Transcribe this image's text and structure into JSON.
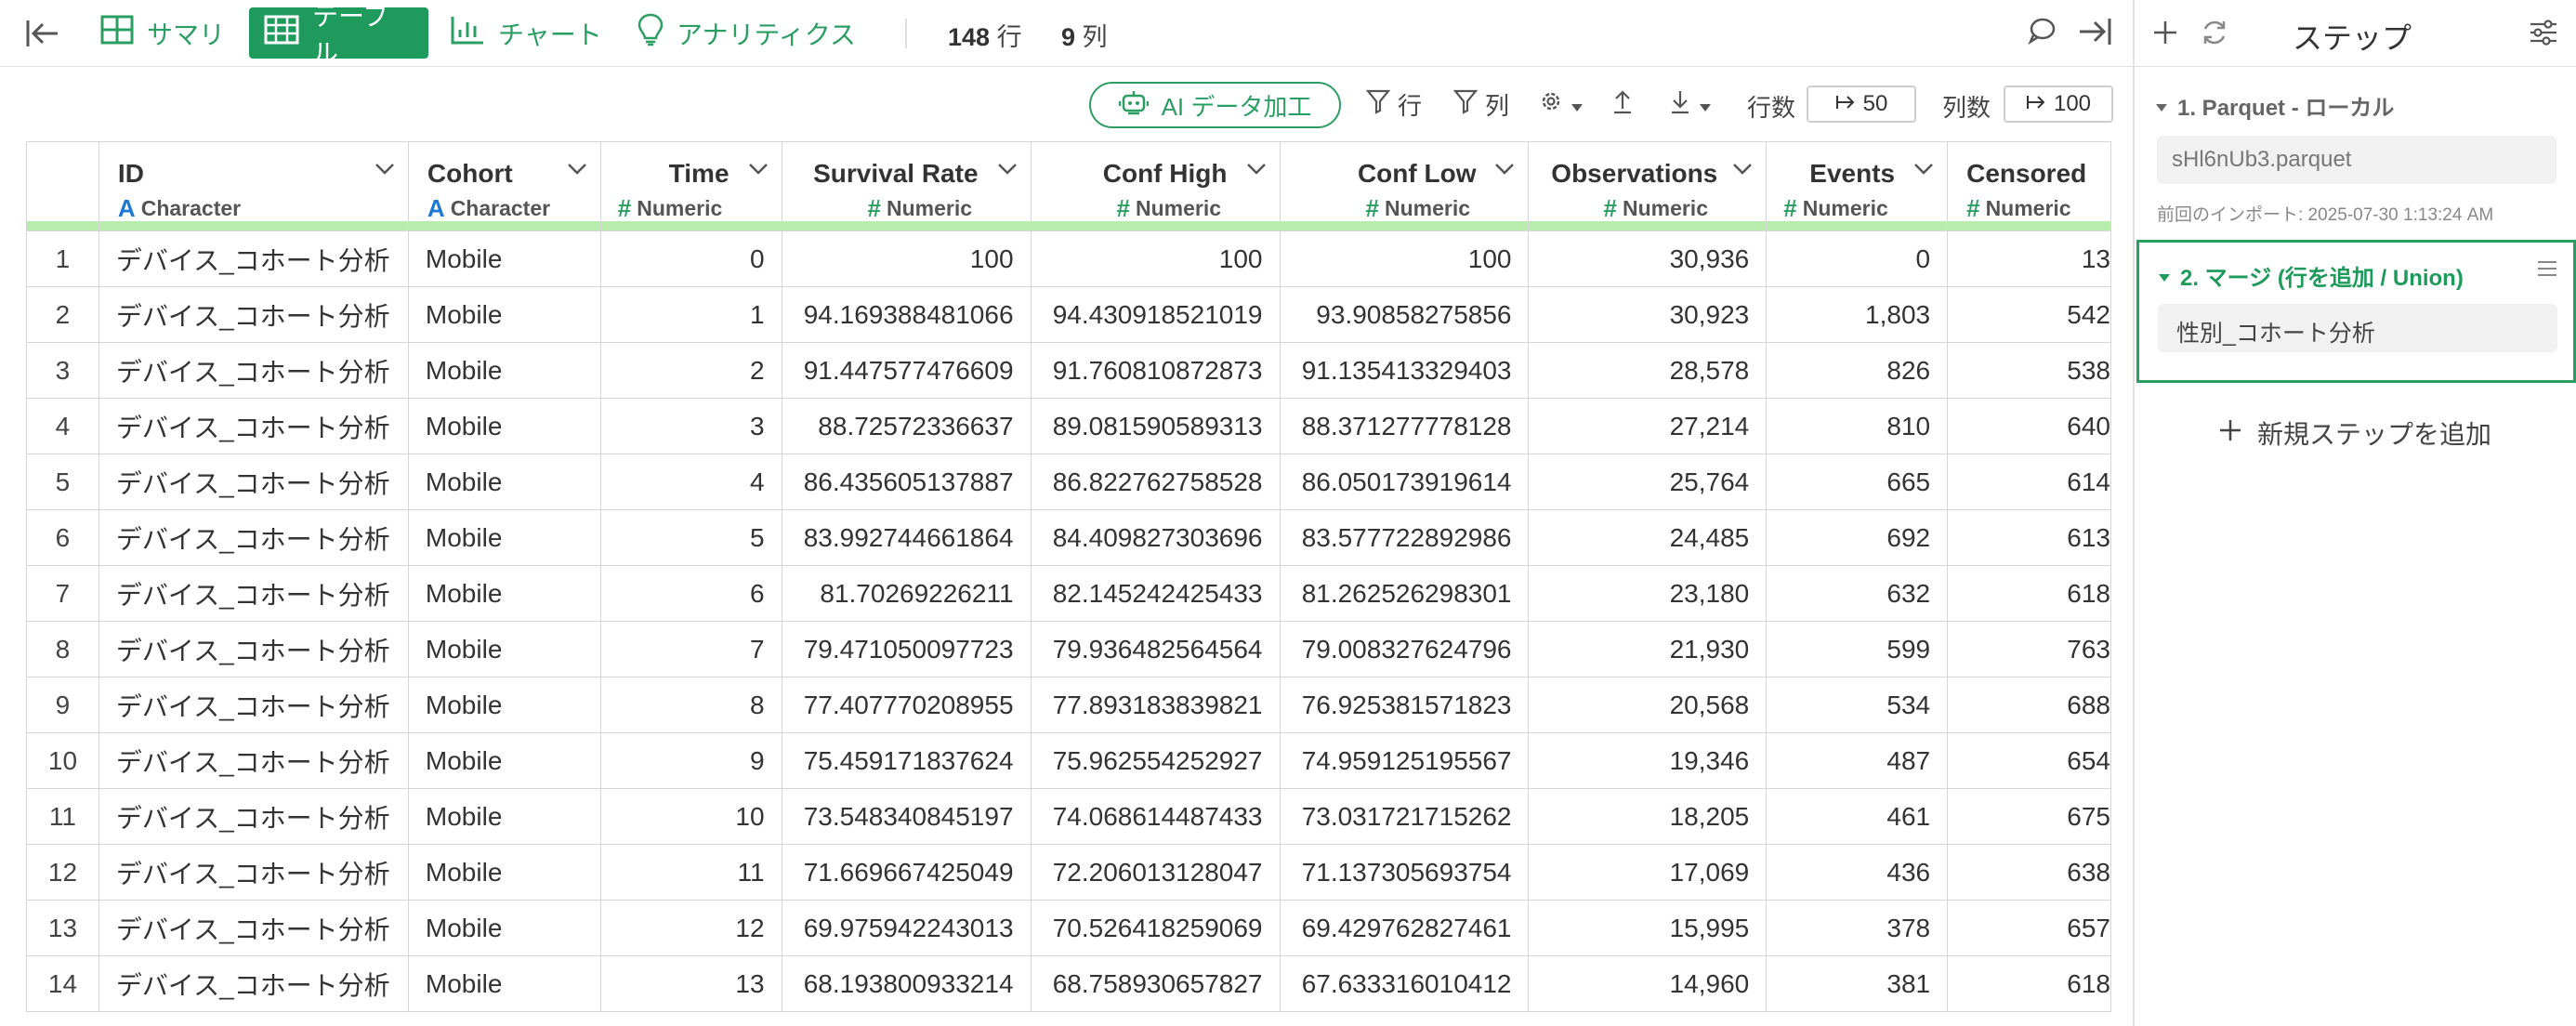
{
  "topbar": {
    "tabs": [
      {
        "label": "サマリ",
        "icon": "summary-icon",
        "active": false
      },
      {
        "label": "テーブル",
        "icon": "table-icon",
        "active": true
      },
      {
        "label": "チャート",
        "icon": "chart-icon",
        "active": false
      },
      {
        "label": "アナリティクス",
        "icon": "lightbulb-icon",
        "active": false
      }
    ],
    "rows_count": "148",
    "rows_unit": "行",
    "cols_count": "9",
    "cols_unit": "列"
  },
  "toolbar": {
    "ai_label": "AI データ加工",
    "filter_rows_label": "行",
    "filter_cols_label": "列",
    "row_limit_label": "行数",
    "row_limit_value": "50",
    "col_limit_label": "列数",
    "col_limit_value": "100"
  },
  "table": {
    "columns": [
      {
        "name": "ID",
        "type": "Character"
      },
      {
        "name": "Cohort",
        "type": "Character"
      },
      {
        "name": "Time",
        "type": "Numeric"
      },
      {
        "name": "Survival Rate",
        "type": "Numeric"
      },
      {
        "name": "Conf High",
        "type": "Numeric"
      },
      {
        "name": "Conf Low",
        "type": "Numeric"
      },
      {
        "name": "Observations",
        "type": "Numeric"
      },
      {
        "name": "Events",
        "type": "Numeric"
      },
      {
        "name": "Censored",
        "type": "Numeric"
      }
    ],
    "rows": [
      [
        "1",
        "デバイス_コホート分析",
        "Mobile",
        "0",
        "100",
        "100",
        "100",
        "30,936",
        "0",
        "13"
      ],
      [
        "2",
        "デバイス_コホート分析",
        "Mobile",
        "1",
        "94.169388481066",
        "94.430918521019",
        "93.90858275856",
        "30,923",
        "1,803",
        "542"
      ],
      [
        "3",
        "デバイス_コホート分析",
        "Mobile",
        "2",
        "91.447577476609",
        "91.760810872873",
        "91.135413329403",
        "28,578",
        "826",
        "538"
      ],
      [
        "4",
        "デバイス_コホート分析",
        "Mobile",
        "3",
        "88.72572336637",
        "89.081590589313",
        "88.371277778128",
        "27,214",
        "810",
        "640"
      ],
      [
        "5",
        "デバイス_コホート分析",
        "Mobile",
        "4",
        "86.435605137887",
        "86.822762758528",
        "86.050173919614",
        "25,764",
        "665",
        "614"
      ],
      [
        "6",
        "デバイス_コホート分析",
        "Mobile",
        "5",
        "83.992744661864",
        "84.409827303696",
        "83.577722892986",
        "24,485",
        "692",
        "613"
      ],
      [
        "7",
        "デバイス_コホート分析",
        "Mobile",
        "6",
        "81.70269226211",
        "82.145242425433",
        "81.262526298301",
        "23,180",
        "632",
        "618"
      ],
      [
        "8",
        "デバイス_コホート分析",
        "Mobile",
        "7",
        "79.471050097723",
        "79.936482564564",
        "79.008327624796",
        "21,930",
        "599",
        "763"
      ],
      [
        "9",
        "デバイス_コホート分析",
        "Mobile",
        "8",
        "77.407770208955",
        "77.893183839821",
        "76.925381571823",
        "20,568",
        "534",
        "688"
      ],
      [
        "10",
        "デバイス_コホート分析",
        "Mobile",
        "9",
        "75.459171837624",
        "75.962554252927",
        "74.959125195567",
        "19,346",
        "487",
        "654"
      ],
      [
        "11",
        "デバイス_コホート分析",
        "Mobile",
        "10",
        "73.548340845197",
        "74.068614487433",
        "73.031721715262",
        "18,205",
        "461",
        "675"
      ],
      [
        "12",
        "デバイス_コホート分析",
        "Mobile",
        "11",
        "71.669667425049",
        "72.206013128047",
        "71.137305693754",
        "17,069",
        "436",
        "638"
      ],
      [
        "13",
        "デバイス_コホート分析",
        "Mobile",
        "12",
        "69.975942243013",
        "70.526418259069",
        "69.429762827461",
        "15,995",
        "378",
        "657"
      ],
      [
        "14",
        "デバイス_コホート分析",
        "Mobile",
        "13",
        "68.193800933214",
        "68.758930657827",
        "67.633316010412",
        "14,960",
        "381",
        "618"
      ]
    ]
  },
  "steps_pane": {
    "title": "ステップ",
    "step1_title": "1. Parquet - ローカル",
    "step1_file": "sHl6nUb3.parquet",
    "step1_note": "前回のインポート: 2025-07-30 1:13:24 AM",
    "step2_title": "2. マージ (行を追加 / Union)",
    "step2_value": "性別_コホート分析",
    "add_step_label": "新規ステップを追加"
  },
  "colors": {
    "accent": "#1e9a5c",
    "accent_text": "#2b9e63",
    "header_bar": "#b7ecac",
    "character_type": "#1f78d1"
  }
}
